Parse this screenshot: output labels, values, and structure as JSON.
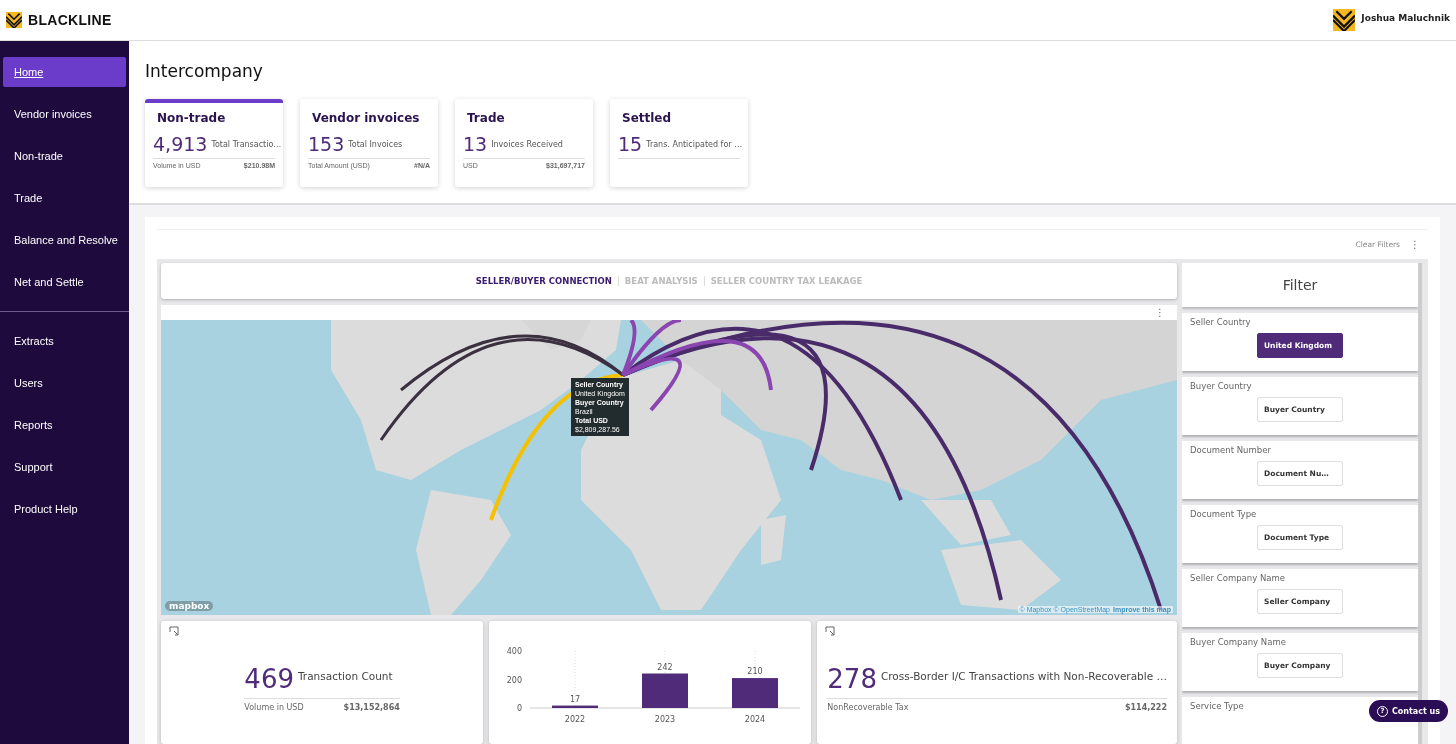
{
  "header": {
    "brand": "BLACKLINE",
    "user": "Joshua Maluchnik"
  },
  "sidebar": {
    "groups": [
      [
        {
          "label": "Home",
          "selected": true
        },
        {
          "label": "Vendor invoices",
          "selected": false
        },
        {
          "label": "Non-trade",
          "selected": false
        },
        {
          "label": "Trade",
          "selected": false
        },
        {
          "label": "Balance and Resolve",
          "selected": false
        },
        {
          "label": "Net and Settle",
          "selected": false
        }
      ],
      [
        {
          "label": "Extracts",
          "selected": false
        },
        {
          "label": "Users",
          "selected": false
        },
        {
          "label": "Reports",
          "selected": false
        },
        {
          "label": "Support",
          "selected": false
        },
        {
          "label": "Product Help",
          "selected": false
        }
      ]
    ]
  },
  "page_title": "Intercompany",
  "kpi_cards": [
    {
      "title": "Non-trade",
      "value": "4,913",
      "label": "Total Transactio…",
      "sub_label": "Volume in USD",
      "sub_value": "$210.98M",
      "selected": true
    },
    {
      "title": "Vendor invoices",
      "value": "153",
      "label": "Total Invoices",
      "sub_label": "Total Amount (USD)",
      "sub_value": "#N/A",
      "selected": false
    },
    {
      "title": "Trade",
      "value": "13",
      "label": "Invoices Received",
      "sub_label": "USD",
      "sub_value": "$31,697,717",
      "selected": false
    },
    {
      "title": "Settled",
      "value": "15",
      "label": "Trans. Anticipated for …",
      "selected": false
    }
  ],
  "toolbar": {
    "clear_filters": "Clear Filters",
    "menu": "⋮"
  },
  "tabs": [
    {
      "label": "SELLER/BUYER CONNECTION",
      "selected": true
    },
    {
      "label": "BEAT ANALYSIS",
      "selected": false
    },
    {
      "label": "SELLER COUNTRY TAX LEAKAGE",
      "selected": false
    }
  ],
  "map": {
    "menu": "⋮",
    "logo": "mapbox",
    "attribution": "© Mapbox © OpenStreetMap",
    "improve_link": "Improve this map",
    "tooltip": [
      {
        "label": "Seller Country",
        "value": "United Kingdom"
      },
      {
        "label": "Buyer Country",
        "value": "Brazil"
      },
      {
        "label": "Total USD",
        "value": "$2,809,287.56"
      }
    ]
  },
  "bottom_cards": [
    {
      "kind": "metric",
      "value": "469",
      "label": "Transaction Count",
      "sub_label": "Volume in USD",
      "sub_value": "$13,152,864"
    },
    {
      "kind": "chart",
      "chart_data": {
        "type": "bar",
        "categories": [
          "2022",
          "2023",
          "2024"
        ],
        "values": [
          17,
          242,
          210
        ],
        "ylim": [
          0,
          400
        ],
        "yticks": [
          0,
          200,
          400
        ],
        "data_labels": true,
        "grid": true
      }
    },
    {
      "kind": "metric",
      "value": "278",
      "label": "Cross-Border  I/C Transactions with Non-Recoverable …",
      "sub_label": "NonRecoverable Tax",
      "sub_value": "$114,222"
    }
  ],
  "filter": {
    "title": "Filter",
    "items": [
      {
        "label": "Seller Country",
        "button": "United Kingdom",
        "filled": true
      },
      {
        "label": "Buyer Country",
        "button": "Buyer Country",
        "filled": false
      },
      {
        "label": "Document Number",
        "button": "Document Nu…",
        "filled": false
      },
      {
        "label": "Document Type",
        "button": "Document Type",
        "filled": false
      },
      {
        "label": "Seller Company Name",
        "button": "Seller Company",
        "filled": false
      },
      {
        "label": "Buyer Company Name",
        "button": "Buyer Company",
        "filled": false
      },
      {
        "label": "Service Type"
      }
    ]
  },
  "contact": {
    "icon": "?",
    "label": "Contact us"
  }
}
